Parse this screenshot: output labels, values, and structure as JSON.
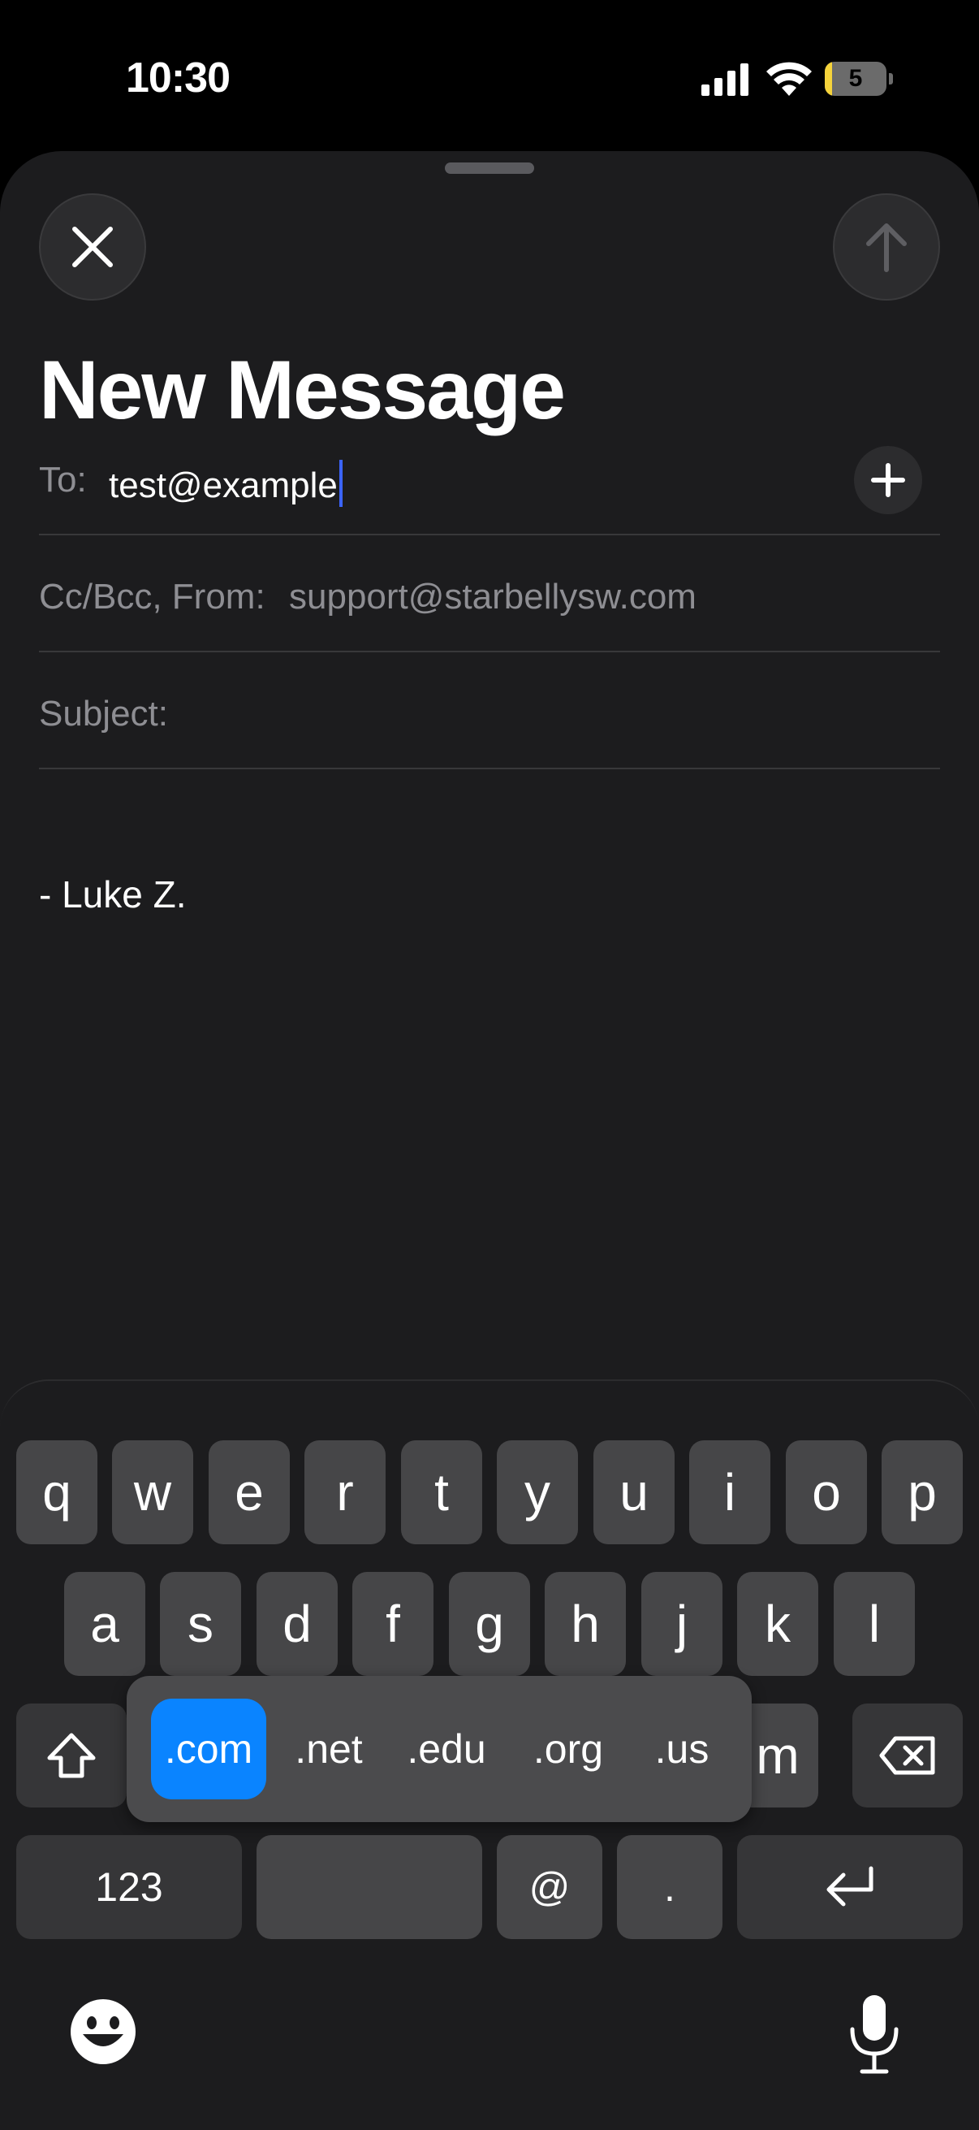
{
  "status": {
    "time": "10:30",
    "battery_level": "5",
    "battery_fraction": 0.05,
    "battery_color": "#f5d33b"
  },
  "compose": {
    "title": "New Message",
    "to_label": "To:",
    "to_value": "test@example",
    "cc_label": "Cc/Bcc, From:",
    "cc_value": "support@starbellysw.com",
    "subject_label": "Subject:",
    "body": "- Luke Z."
  },
  "icons": {
    "close": "close-icon",
    "send": "arrow-up-icon",
    "add": "plus-icon",
    "shift": "shift-icon",
    "delete": "backspace-icon",
    "return": "return-icon",
    "emoji": "emoji-icon",
    "mic": "microphone-icon"
  },
  "keyboard": {
    "row1": [
      "q",
      "w",
      "e",
      "r",
      "t",
      "y",
      "u",
      "i",
      "o",
      "p"
    ],
    "row2": [
      "a",
      "s",
      "d",
      "f",
      "g",
      "h",
      "j",
      "k",
      "l"
    ],
    "row3_visible": [
      "m"
    ],
    "numbers_label": "123",
    "at_label": "@",
    "dot_label": ".",
    "suggestions": [
      ".com",
      ".net",
      ".edu",
      ".org",
      ".us"
    ],
    "selected_suggestion": ".com",
    "accent_color": "#0a84ff"
  }
}
